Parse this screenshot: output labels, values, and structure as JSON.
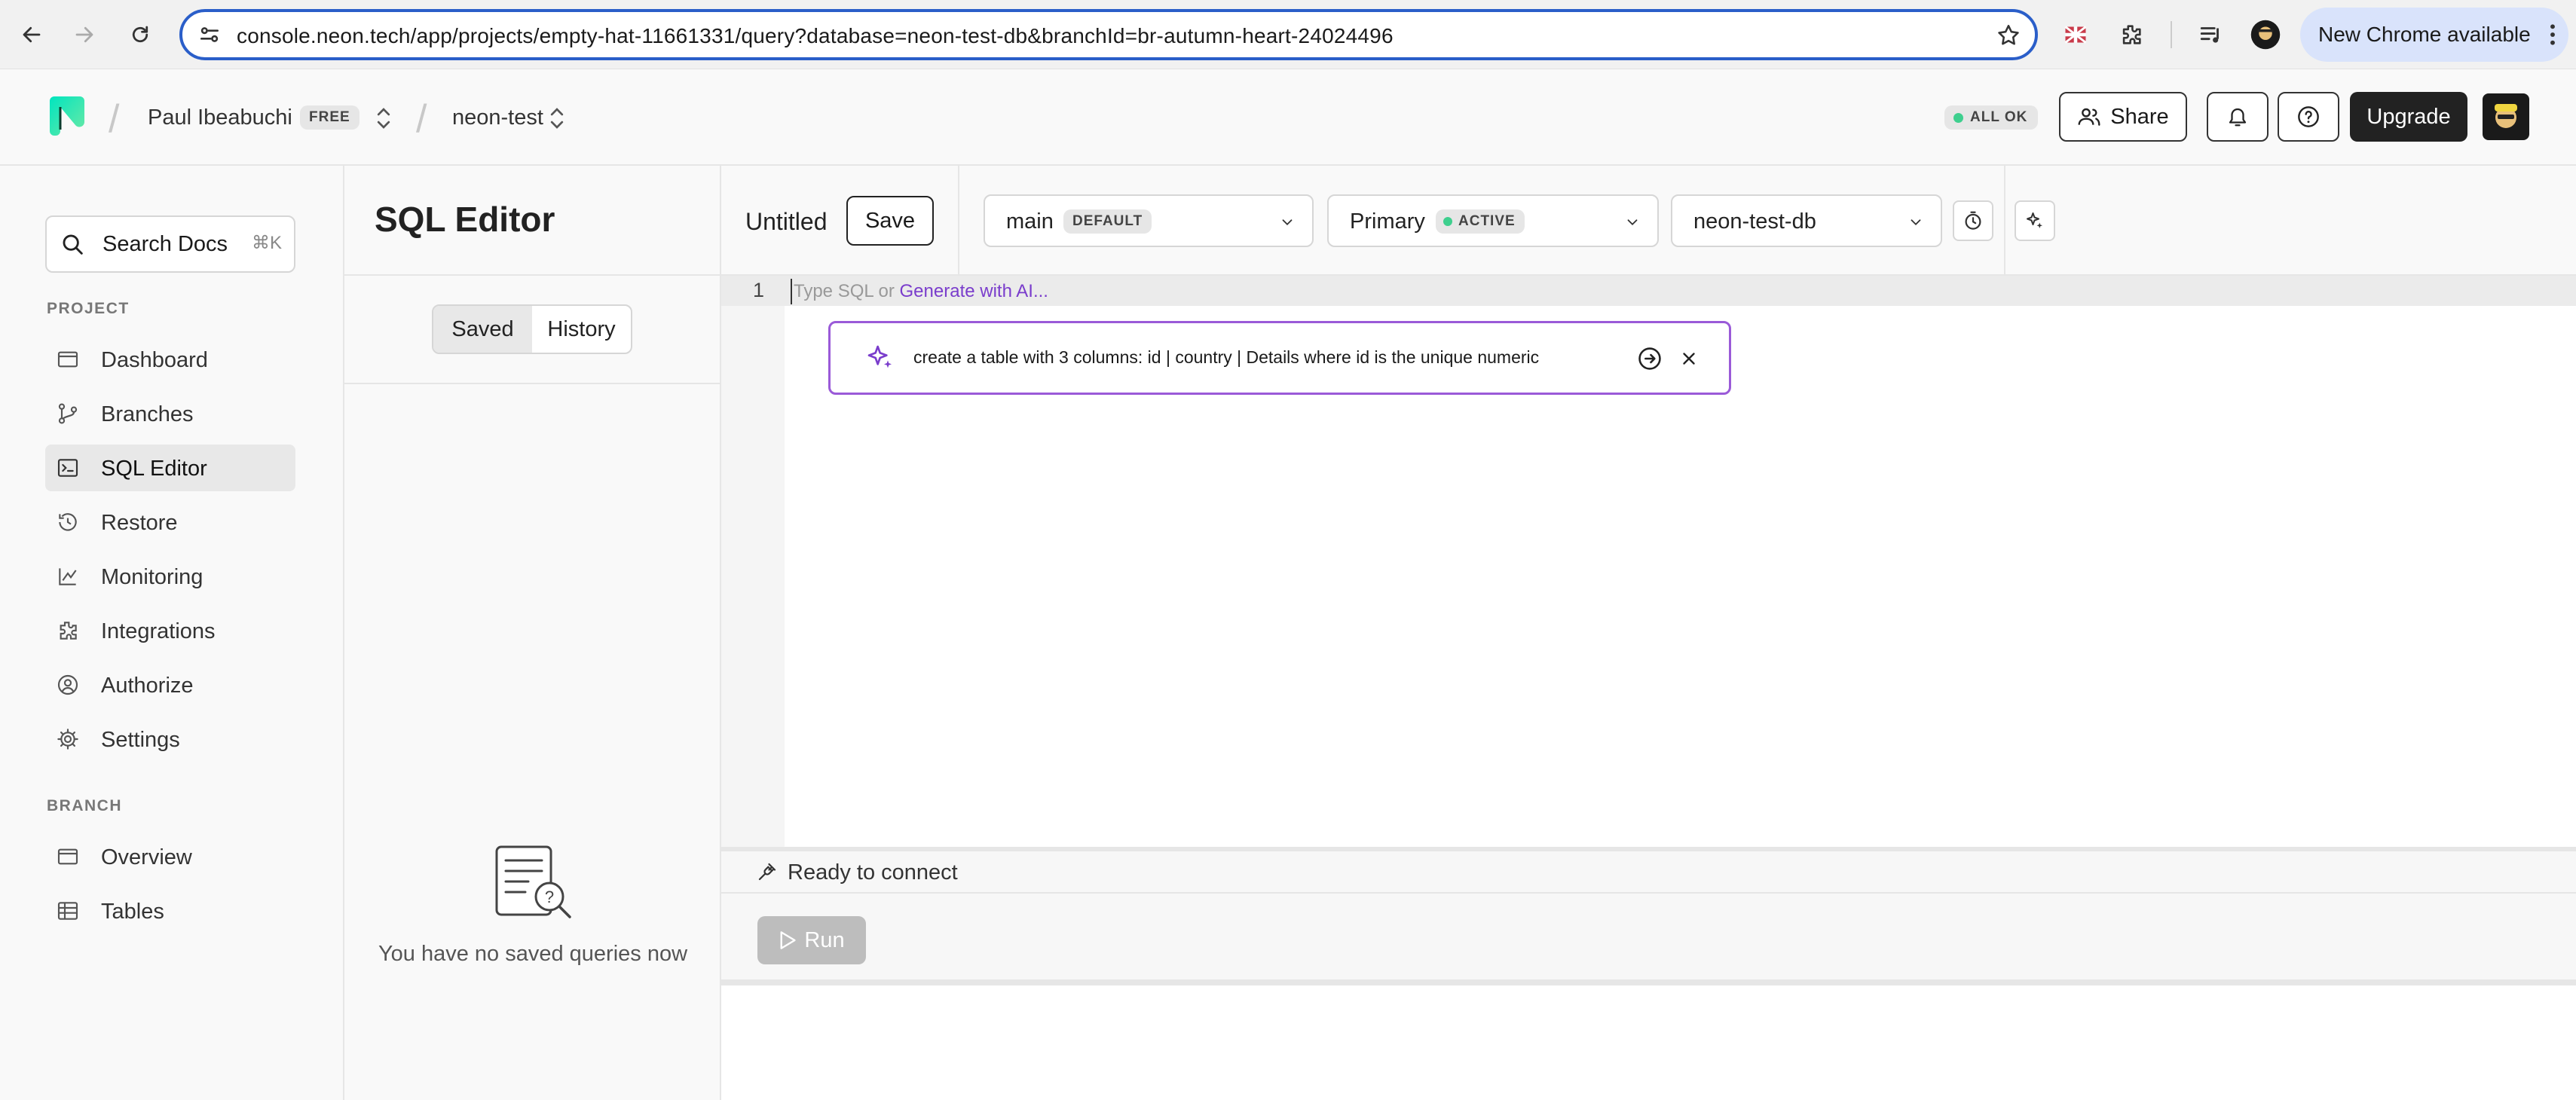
{
  "browser": {
    "url": "console.neon.tech/app/projects/empty-hat-11661331/query?database=neon-test-db&branchId=br-autumn-heart-24024496",
    "new_chrome_label": "New Chrome available"
  },
  "header": {
    "user_name": "Paul Ibeabuchi",
    "plan_badge": "FREE",
    "project_name": "neon-test",
    "status_label": "ALL OK",
    "share_label": "Share",
    "upgrade_label": "Upgrade"
  },
  "sidebar": {
    "search_label": "Search Docs",
    "search_shortcut": "⌘K",
    "project_section": "PROJECT",
    "project_items": [
      {
        "label": "Dashboard",
        "icon": "dashboard-icon"
      },
      {
        "label": "Branches",
        "icon": "branches-icon"
      },
      {
        "label": "SQL Editor",
        "icon": "sql-editor-icon",
        "active": true
      },
      {
        "label": "Restore",
        "icon": "restore-icon"
      },
      {
        "label": "Monitoring",
        "icon": "monitoring-icon"
      },
      {
        "label": "Integrations",
        "icon": "integrations-icon"
      },
      {
        "label": "Authorize",
        "icon": "authorize-icon"
      },
      {
        "label": "Settings",
        "icon": "settings-icon"
      }
    ],
    "branch_section": "BRANCH",
    "branch_items": [
      {
        "label": "Overview",
        "icon": "overview-icon"
      },
      {
        "label": "Tables",
        "icon": "tables-icon"
      }
    ]
  },
  "panel": {
    "title": "SQL Editor",
    "tab_saved": "Saved",
    "tab_history": "History",
    "active_tab": "Saved",
    "empty_message": "You have no saved queries now"
  },
  "editor": {
    "query_name": "Untitled",
    "save_label": "Save",
    "branch_value": "main",
    "branch_badge": "DEFAULT",
    "compute_value": "Primary",
    "compute_badge": "ACTIVE",
    "database_value": "neon-test-db",
    "line_number": "1",
    "placeholder_prefix": "Type SQL or ",
    "placeholder_link": "Generate with AI...",
    "ai_prompt": "create a table with 3 columns: id | country | Details where id is the unique numeric",
    "connection_status": "Ready to connect",
    "run_label": "Run"
  },
  "colors": {
    "accent_purple": "#7a3dcc",
    "status_green": "#3ecf8e",
    "url_focus": "#2a5ec9"
  }
}
